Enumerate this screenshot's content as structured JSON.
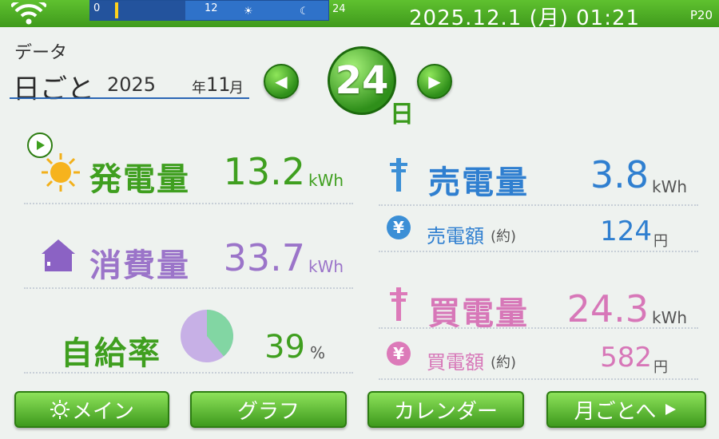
{
  "status_bar": {
    "timeline_start": "0",
    "timeline_mid": "12",
    "timeline_end": "24",
    "clock": "2025.12.1 (月) 01:21",
    "page": "P20"
  },
  "header": {
    "section": "データ",
    "mode": "日ごと",
    "year": "2025",
    "year_unit": "年",
    "month": "11",
    "month_unit": "月",
    "day": "24",
    "day_unit": "日",
    "prev_symbol": "◀",
    "next_symbol": "▶"
  },
  "generation": {
    "label": "発電量",
    "value": "13.2",
    "unit": "kWh"
  },
  "consumption": {
    "label": "消費量",
    "value": "33.7",
    "unit": "kWh"
  },
  "self_sufficiency": {
    "label": "自給率",
    "value": "39",
    "unit": "%",
    "fraction": 0.39
  },
  "sold": {
    "label": "売電量",
    "value": "3.8",
    "unit": "kWh"
  },
  "sold_amount": {
    "label": "売電額",
    "note": "(約)",
    "value": "124",
    "unit": "円",
    "icon": "¥"
  },
  "bought": {
    "label": "買電量",
    "value": "24.3",
    "unit": "kWh"
  },
  "bought_amount": {
    "label": "買電額",
    "note": "(約)",
    "value": "582",
    "unit": "円",
    "icon": "¥"
  },
  "footer": {
    "main": "メイン",
    "graph": "グラフ",
    "calendar": "カレンダー",
    "monthly": "月ごとへ"
  },
  "colors": {
    "green": "#3f9f1f",
    "purple": "#9b74c9",
    "blue": "#2f7fd0",
    "pink": "#d777b8"
  }
}
